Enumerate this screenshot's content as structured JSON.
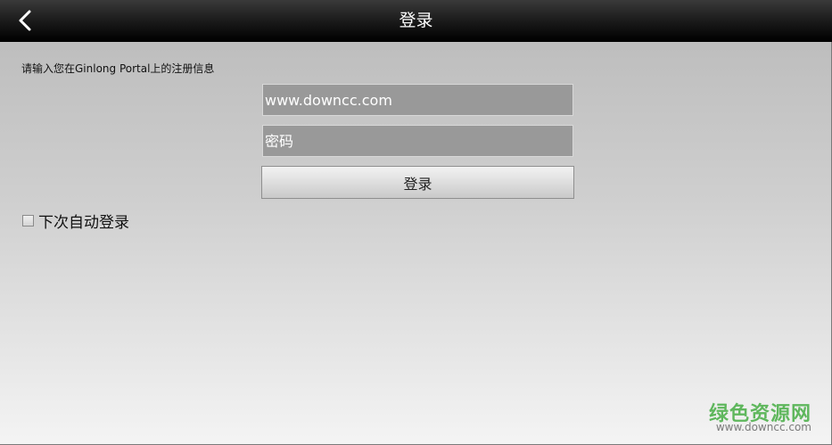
{
  "header": {
    "title": "登录",
    "back_icon": "chevron-left-icon"
  },
  "form": {
    "hint": "请输入您在Ginlong Portal上的注册信息",
    "username_value": "www.downcc.com",
    "password_placeholder": "密码",
    "login_label": "登录",
    "remember_label": "下次自动登录",
    "remember_checked": false
  },
  "watermark": {
    "title": "绿色资源网",
    "url": "www.downcc.com"
  },
  "colors": {
    "titlebar": "#000000",
    "field_bg": "#999999",
    "watermark_green": "#5fb75d"
  }
}
